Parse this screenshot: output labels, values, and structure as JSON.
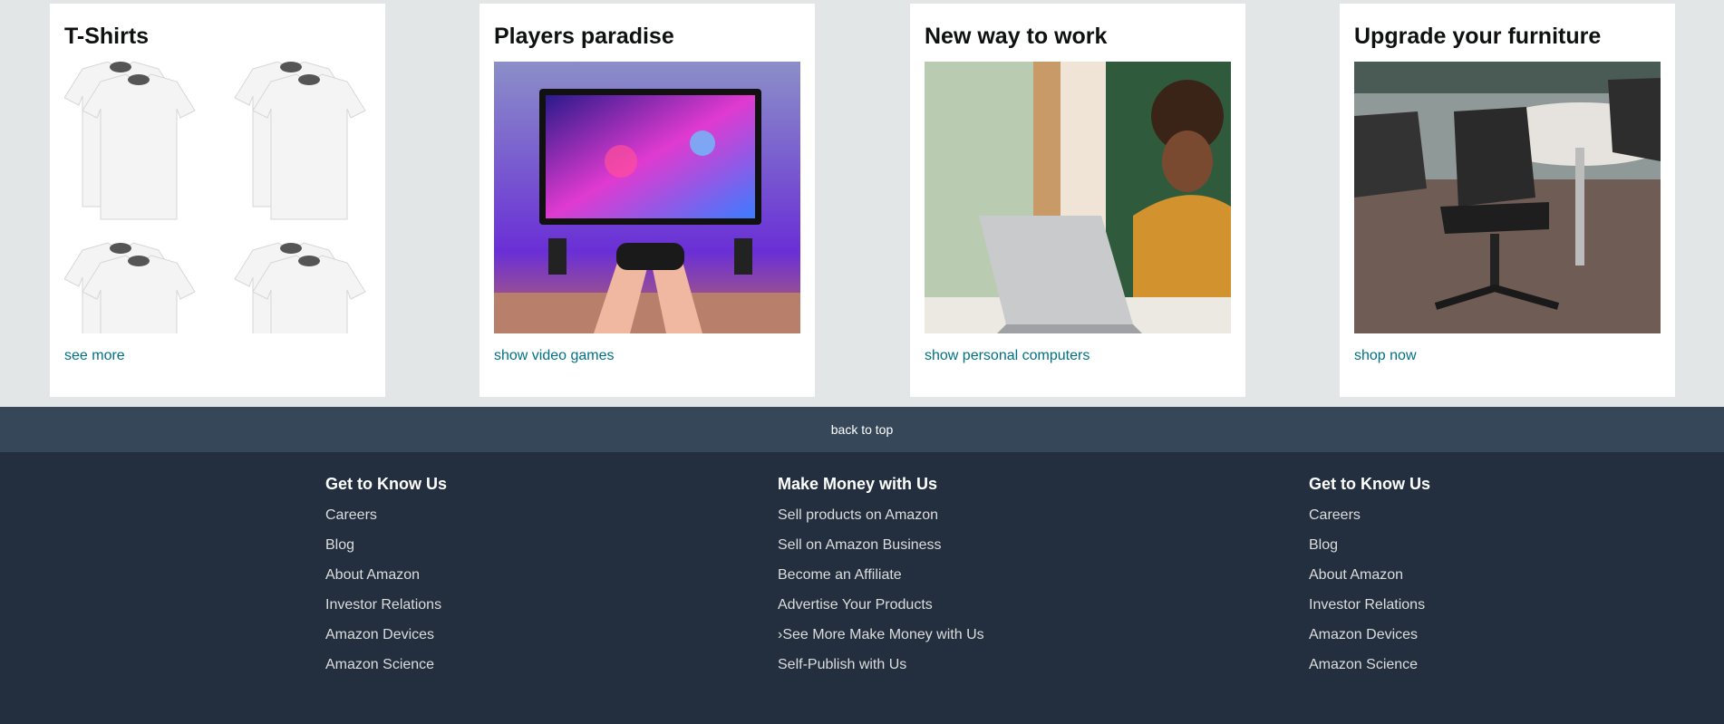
{
  "cards": [
    {
      "title": "T-Shirts",
      "link": "see more"
    },
    {
      "title": "Players paradise",
      "link": "show video games"
    },
    {
      "title": "New way to work",
      "link": "show personal computers"
    },
    {
      "title": "Upgrade your furniture",
      "link": "shop now"
    }
  ],
  "back_to_top": "back to top",
  "footer": {
    "columns": [
      {
        "heading": "Get to Know Us",
        "items": [
          "Careers",
          "Blog",
          "About Amazon",
          "Investor Relations",
          "Amazon Devices",
          "Amazon Science"
        ]
      },
      {
        "heading": "Make Money with Us",
        "items": [
          "Sell products on Amazon",
          "Sell on Amazon Business",
          "Become an Affiliate",
          "Advertise Your Products",
          "›See More Make Money with Us",
          "Self-Publish with Us"
        ]
      },
      {
        "heading": "Get to Know Us",
        "items": [
          "Careers",
          "Blog",
          "About Amazon",
          "Investor Relations",
          "Amazon Devices",
          "Amazon Science"
        ]
      }
    ]
  },
  "colors": {
    "link": "#007185",
    "back_to_top_bg": "#37475a",
    "footer_bg": "#232f3e",
    "page_bg": "#e3e6e6"
  }
}
